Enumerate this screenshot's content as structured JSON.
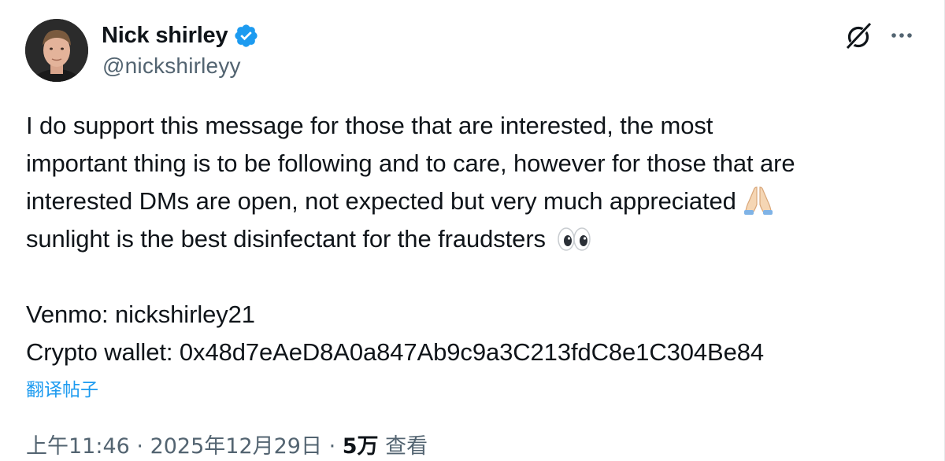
{
  "author": {
    "display_name": "Nick shirley",
    "handle": "@nickshirleyy",
    "verified": true,
    "verified_color": "#1d9bf0"
  },
  "header_icons": [
    "grok-icon",
    "more-icon"
  ],
  "tweet": {
    "lines": [
      "I do support this message for those that are interested, the most",
      "important thing is to be following and to care, however for those that are",
      "interested DMs are open, not expected but very much appreciated",
      "sunlight is the best disinfectant for the fraudsters"
    ],
    "emojis": [
      "folded-hands",
      "eyes"
    ],
    "venmo": "Venmo: nickshirley21",
    "crypto": "Crypto wallet: 0x48d7eAeD8A0a847Ab9c9a3C213fdC8e1C304Be84"
  },
  "translate_label": "翻译帖子",
  "meta": {
    "time": "上午11:46",
    "sep1": " · ",
    "date": "2025年12月29日",
    "sep2": " · ",
    "views_count": "5万",
    "views_label": " 查看"
  },
  "colors": {
    "text": "#0f1419",
    "secondary": "#536471",
    "link": "#1d9bf0"
  }
}
